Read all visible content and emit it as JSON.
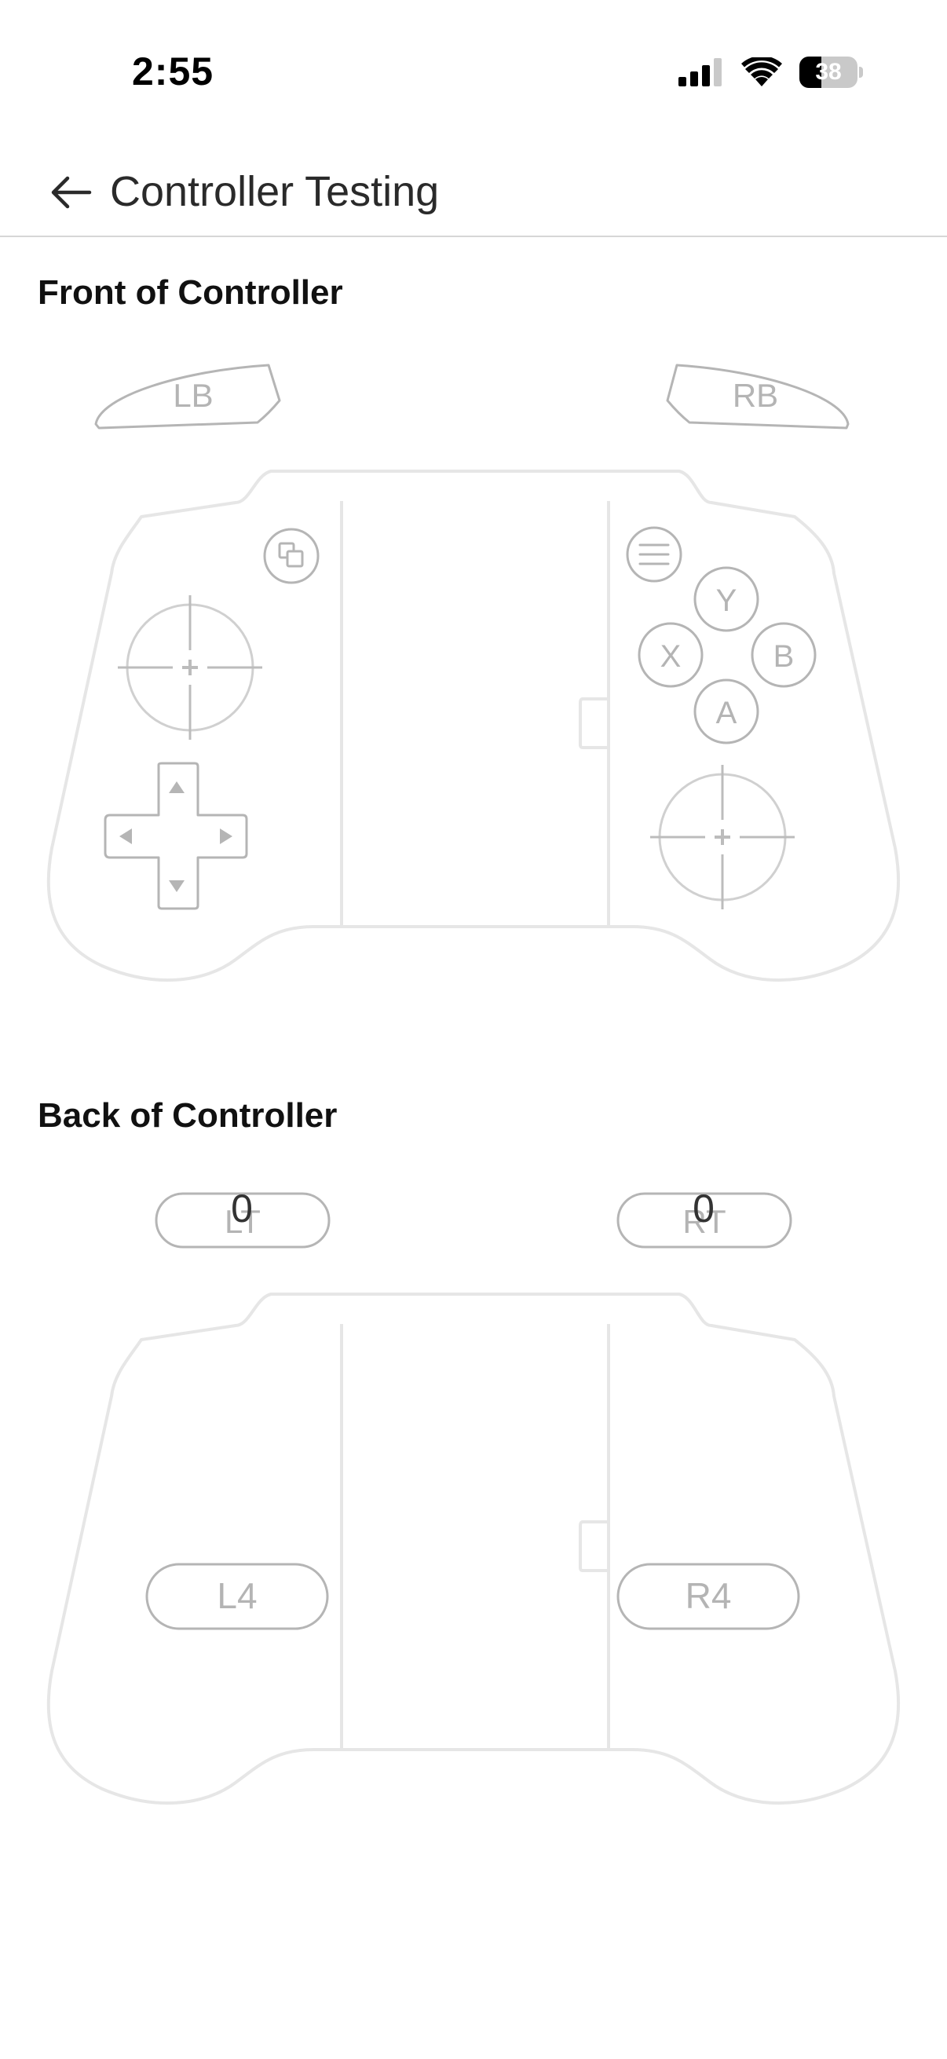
{
  "status_bar": {
    "time": "2:55",
    "battery_level": "38",
    "battery_fraction": 0.38,
    "signal_icon": "cellular-signal-icon",
    "wifi_icon": "wifi-icon"
  },
  "header": {
    "back_icon": "arrow-left-icon",
    "title": "Controller Testing"
  },
  "front": {
    "section_title": "Front of Controller",
    "lb_label": "LB",
    "rb_label": "RB",
    "y_label": "Y",
    "x_label": "X",
    "b_label": "B",
    "a_label": "A",
    "view_icon": "view-button-icon",
    "menu_icon": "menu-button-icon"
  },
  "back": {
    "section_title": "Back of Controller",
    "lt_label": "LT",
    "rt_label": "RT",
    "lt_value": "0",
    "rt_value": "0",
    "l4_label": "L4",
    "r4_label": "R4"
  },
  "colors": {
    "outline": "#e6e6e6",
    "button_outline": "#b5b5b5",
    "label": "#b4b4b4",
    "divider": "#d6d6d6"
  }
}
